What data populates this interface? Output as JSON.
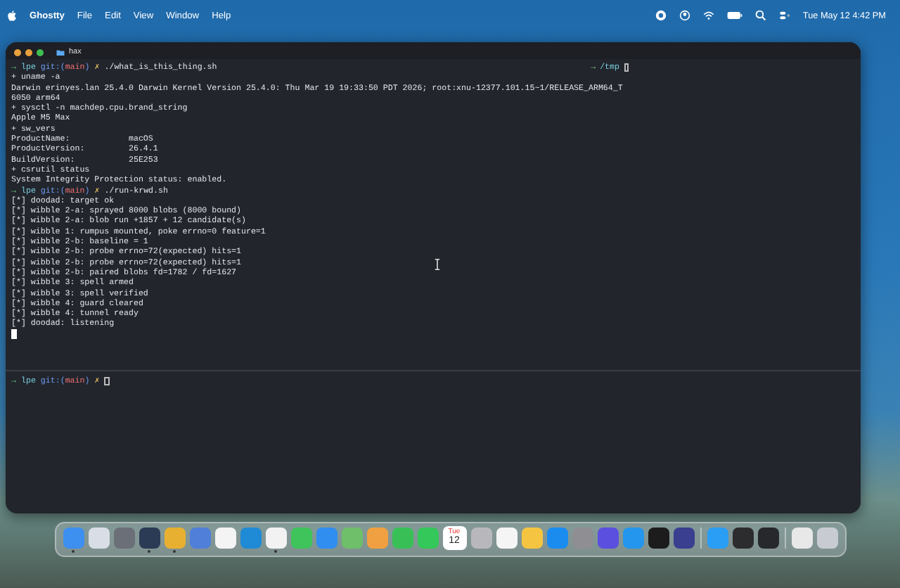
{
  "menu_bar": {
    "app_name": "Ghostty",
    "menus": [
      "File",
      "Edit",
      "View",
      "Window",
      "Help"
    ],
    "clock": "Tue May 12  4:42 PM"
  },
  "window": {
    "title": "hax",
    "traffic_lights": [
      {
        "color": "#e8a03c"
      },
      {
        "color": "#e8a03c"
      },
      {
        "color": "#3fbf4f"
      }
    ]
  },
  "top_pane": {
    "right_prompt": {
      "arrow": "→",
      "path": "/tmp"
    },
    "lines": [
      {
        "kind": "prompt",
        "arrow": "→",
        "dir": "lpe",
        "git": "git:(",
        "branch": "main",
        "git_end": ")",
        "dirty": "✗",
        "command": "./what_is_this_thing.sh"
      },
      {
        "kind": "trace",
        "text": "+ uname -a"
      },
      {
        "kind": "output",
        "text": "Darwin erinyes.lan 25.4.0 Darwin Kernel Version 25.4.0: Thu Mar 19 19:33:50 PDT 2026; root:xnu-12377.101.15~1/RELEASE_ARM64_T"
      },
      {
        "kind": "output",
        "text": "6050 arm64"
      },
      {
        "kind": "trace",
        "text": "+ sysctl -n machdep.cpu.brand_string"
      },
      {
        "kind": "output",
        "text": "Apple M5 Max"
      },
      {
        "kind": "trace",
        "text": "+ sw_vers"
      },
      {
        "kind": "output",
        "text": "ProductName:            macOS"
      },
      {
        "kind": "output",
        "text": "ProductVersion:         26.4.1"
      },
      {
        "kind": "output",
        "text": "BuildVersion:           25E253"
      },
      {
        "kind": "trace",
        "text": "+ csrutil status"
      },
      {
        "kind": "output",
        "text": "System Integrity Protection status: enabled."
      },
      {
        "kind": "prompt",
        "arrow": "→",
        "dir": "lpe",
        "git": "git:(",
        "branch": "main",
        "git_end": ")",
        "dirty": "✗",
        "command": "./run-krwd.sh"
      },
      {
        "kind": "output",
        "text": "[*] doodad: target ok"
      },
      {
        "kind": "output",
        "text": "[*] wibble 2-a: sprayed 8000 blobs (8000 bound)"
      },
      {
        "kind": "output",
        "text": "[*] wibble 2-a: blob run +1857 + 12 candidate(s)"
      },
      {
        "kind": "output",
        "text": "[*] wibble 1: rumpus mounted, poke errno=0 feature=1"
      },
      {
        "kind": "output",
        "text": "[*] wibble 2-b: baseline = 1"
      },
      {
        "kind": "output",
        "text": "[*] wibble 2-b: probe errno=72(expected) hits=1"
      },
      {
        "kind": "output",
        "text": "[*] wibble 2-b: probe errno=72(expected) hits=1"
      },
      {
        "kind": "output",
        "text": "[*] wibble 2-b: paired blobs fd=1782 / fd=1627"
      },
      {
        "kind": "output",
        "text": "[*] wibble 3: spell armed"
      },
      {
        "kind": "output",
        "text": "[*] wibble 3: spell verified"
      },
      {
        "kind": "output",
        "text": "[*] wibble 4: guard cleared"
      },
      {
        "kind": "output",
        "text": "[*] wibble 4: tunnel ready"
      },
      {
        "kind": "output",
        "text": "[*] doodad: listening"
      },
      {
        "kind": "cursor"
      }
    ]
  },
  "bottom_pane": {
    "prompt": {
      "arrow": "→",
      "dir": "lpe",
      "git": "git:(",
      "branch": "main",
      "git_end": ")",
      "dirty": "✗"
    }
  },
  "dock": {
    "items": [
      {
        "kind": "app",
        "color": "#3d8ff0",
        "running": true
      },
      {
        "kind": "app",
        "color": "#d8dde6",
        "running": false
      },
      {
        "kind": "app",
        "color": "#6b6f78",
        "running": false
      },
      {
        "kind": "app",
        "color": "#2b3a55",
        "running": true
      },
      {
        "kind": "app",
        "color": "#e8b030",
        "running": true
      },
      {
        "kind": "app",
        "color": "#4f7fd8",
        "running": false
      },
      {
        "kind": "app",
        "color": "#f4f4f4",
        "running": false
      },
      {
        "kind": "app",
        "color": "#1f8ad6",
        "running": false
      },
      {
        "kind": "app",
        "color": "#f2f2f2",
        "running": true
      },
      {
        "kind": "app",
        "color": "#3ec45a",
        "running": false
      },
      {
        "kind": "app",
        "color": "#2f8ef0",
        "running": false
      },
      {
        "kind": "app",
        "color": "#6fbf6a",
        "running": false
      },
      {
        "kind": "app",
        "color": "#f0a040",
        "running": false
      },
      {
        "kind": "app",
        "color": "#38c057",
        "running": false
      },
      {
        "kind": "app",
        "color": "#34c759",
        "running": false
      },
      {
        "kind": "calendar",
        "day": "Tue",
        "date": "12",
        "running": false
      },
      {
        "kind": "app",
        "color": "#b8b8bc",
        "running": false
      },
      {
        "kind": "app",
        "color": "#f5f5f5",
        "running": false
      },
      {
        "kind": "app",
        "color": "#f5c542",
        "running": false
      },
      {
        "kind": "app",
        "color": "#1a8cf0",
        "running": false
      },
      {
        "kind": "app",
        "color": "#8e8e93",
        "running": false
      },
      {
        "kind": "app",
        "color": "#5b4fe0",
        "running": false
      },
      {
        "kind": "app",
        "color": "#2496ed",
        "running": false
      },
      {
        "kind": "app",
        "color": "#1c1c1c",
        "running": false
      },
      {
        "kind": "app",
        "color": "#3a3f8f",
        "running": false
      },
      {
        "kind": "separator"
      },
      {
        "kind": "app",
        "color": "#2a9df4",
        "running": false
      },
      {
        "kind": "app",
        "color": "#2c2c2e",
        "running": false
      },
      {
        "kind": "app",
        "color": "#26282b",
        "running": false
      },
      {
        "kind": "separator"
      },
      {
        "kind": "app",
        "color": "#e8e8e8",
        "running": false
      },
      {
        "kind": "app",
        "color": "#c8ccd2",
        "running": false
      }
    ]
  }
}
